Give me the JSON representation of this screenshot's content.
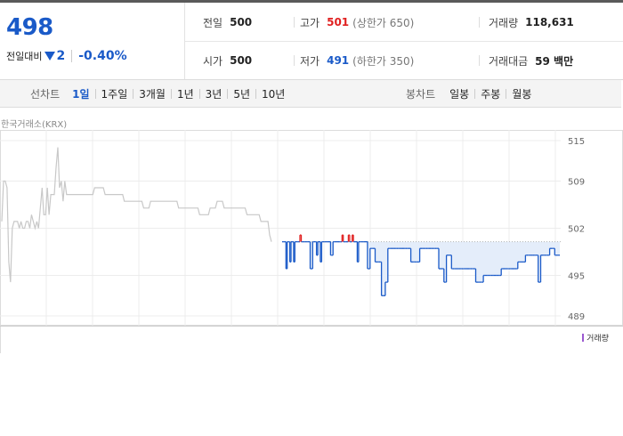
{
  "summary": {
    "price": "498",
    "change_label": "전일대비",
    "change_amount": "2",
    "change_pct": "-0.40%",
    "prev_close": {
      "label": "전일",
      "value": "500"
    },
    "high": {
      "label": "고가",
      "value": "501",
      "limit": "(상한가 650)"
    },
    "volume": {
      "label": "거래량",
      "value": "118,631"
    },
    "open": {
      "label": "시가",
      "value": "500"
    },
    "low": {
      "label": "저가",
      "value": "491",
      "limit": "(하한가 350)"
    },
    "amount": {
      "label": "거래대금",
      "value": "59 백만"
    }
  },
  "tabs": {
    "line_label": "선차트",
    "line_items": [
      "1일",
      "1주일",
      "3개월",
      "1년",
      "3년",
      "5년",
      "10년"
    ],
    "selected": "1일",
    "candle_label": "봉차트",
    "candle_items": [
      "일봉",
      "주봉",
      "월봉"
    ]
  },
  "exchange": "한국거래소(KRX)",
  "colors": {
    "accent": "#1a5ac8",
    "up": "#e02020",
    "prev_day": "#c8c8c8",
    "fill": "#e4edfa"
  },
  "chart_data": {
    "type": "line",
    "ylim": [
      489,
      515
    ],
    "yticks": [
      "515",
      "509",
      "502",
      "495",
      "489"
    ],
    "reference_line": 500,
    "series": [
      {
        "values": [
          503,
          509,
          509,
          508,
          497,
          494,
          502,
          503,
          503,
          503,
          502,
          503,
          502,
          502,
          503,
          503,
          502,
          504,
          503,
          502,
          503,
          502,
          505,
          508,
          504,
          504,
          508,
          504,
          507,
          507,
          507,
          511,
          514,
          508,
          509,
          506,
          509,
          507,
          507,
          507,
          507,
          507,
          507,
          507,
          507,
          507,
          507,
          507,
          507,
          507,
          507,
          507,
          507,
          508,
          508,
          508,
          508,
          508,
          508,
          507,
          507,
          507,
          507,
          507,
          507,
          507,
          507,
          507,
          507,
          507,
          506,
          506,
          506,
          506,
          506,
          506,
          506,
          506,
          506,
          506,
          506,
          505,
          505,
          505,
          505,
          506,
          506,
          506,
          506,
          506,
          506,
          506,
          506,
          506,
          506,
          506,
          506,
          506,
          506,
          506,
          506,
          505,
          505,
          505,
          505,
          505,
          505,
          505,
          505,
          505,
          505,
          505,
          505,
          504,
          504,
          504,
          504,
          504,
          504,
          505,
          505,
          505,
          505,
          506,
          506,
          506,
          506,
          505,
          505,
          505,
          505,
          505,
          505,
          505,
          505,
          505,
          505,
          505,
          505,
          505,
          504,
          504,
          504,
          504,
          504,
          504,
          504,
          504,
          503,
          503,
          503,
          503,
          503,
          501,
          500
        ]
      },
      {
        "values": [
          500,
          500,
          500,
          496,
          500,
          500,
          497,
          500,
          500,
          497,
          500,
          500,
          500,
          500,
          501,
          500,
          500,
          500,
          500,
          500,
          500,
          500,
          496,
          496,
          500,
          500,
          500,
          498,
          500,
          500,
          497,
          500,
          500,
          500,
          500,
          500,
          500,
          500,
          498,
          498,
          500,
          500,
          500,
          500,
          500,
          500,
          500,
          501,
          500,
          500,
          500,
          500,
          501,
          500,
          500,
          501,
          500,
          500,
          500,
          497,
          500,
          500,
          500,
          500,
          500,
          500,
          500,
          496,
          496,
          499,
          499,
          499,
          499,
          497,
          497,
          497,
          497,
          497,
          492,
          492,
          492,
          494,
          494,
          499,
          499,
          499,
          499,
          499,
          499,
          499,
          499,
          499,
          499,
          499,
          499,
          499,
          499,
          499,
          499,
          499,
          499,
          497,
          497,
          497,
          497,
          497,
          497,
          497,
          499,
          499,
          499,
          499,
          499,
          499,
          499,
          499,
          499,
          499,
          499,
          499,
          499,
          499,
          499,
          496,
          496,
          496,
          496,
          494,
          494,
          498,
          498,
          498,
          498,
          496,
          496,
          496,
          496,
          496,
          496,
          496,
          496,
          496,
          496,
          496,
          496,
          496,
          496,
          496,
          496,
          496,
          496,
          496,
          494,
          494,
          494,
          494,
          494,
          494,
          495,
          495,
          495,
          495,
          495,
          495,
          495,
          495,
          495,
          495,
          495,
          495,
          495,
          495,
          496,
          496,
          496,
          496,
          496,
          496,
          496,
          496,
          496,
          496,
          496,
          496,
          496,
          497,
          497,
          497,
          497,
          497,
          497,
          498,
          498,
          498,
          498,
          498,
          498,
          498,
          498,
          498,
          498,
          494,
          494,
          498,
          498,
          498,
          498,
          498,
          498,
          498,
          499,
          499,
          499,
          499,
          498,
          498,
          498,
          498,
          498
        ]
      }
    ]
  }
}
